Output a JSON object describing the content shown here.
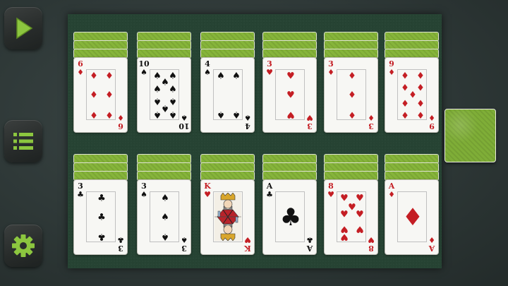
{
  "sidebar": [
    {
      "id": "play",
      "icon": "play-icon"
    },
    {
      "id": "menu",
      "icon": "menu-icon"
    },
    {
      "id": "settings",
      "icon": "gear-icon"
    }
  ],
  "colors": {
    "felt": "#264333",
    "card_back": "#86b53a",
    "red_suit": "#c41e24",
    "black_suit": "#111111",
    "sidebar_icon": "#8cc63f"
  },
  "game": {
    "piles": [
      {
        "rank": "6",
        "suit": "diamonds",
        "hidden_cards": 3
      },
      {
        "rank": "10",
        "suit": "spades",
        "hidden_cards": 3
      },
      {
        "rank": "4",
        "suit": "spades",
        "hidden_cards": 3
      },
      {
        "rank": "3",
        "suit": "hearts",
        "hidden_cards": 3
      },
      {
        "rank": "3",
        "suit": "diamonds",
        "hidden_cards": 3
      },
      {
        "rank": "9",
        "suit": "diamonds",
        "hidden_cards": 3
      },
      {
        "rank": "3",
        "suit": "clubs",
        "hidden_cards": 3
      },
      {
        "rank": "3",
        "suit": "spades",
        "hidden_cards": 3
      },
      {
        "rank": "K",
        "suit": "hearts",
        "hidden_cards": 3
      },
      {
        "rank": "A",
        "suit": "clubs",
        "hidden_cards": 3
      },
      {
        "rank": "8",
        "suit": "hearts",
        "hidden_cards": 3
      },
      {
        "rank": "A",
        "suit": "diamonds",
        "hidden_cards": 3
      }
    ],
    "stock": {
      "face_down": true
    }
  }
}
